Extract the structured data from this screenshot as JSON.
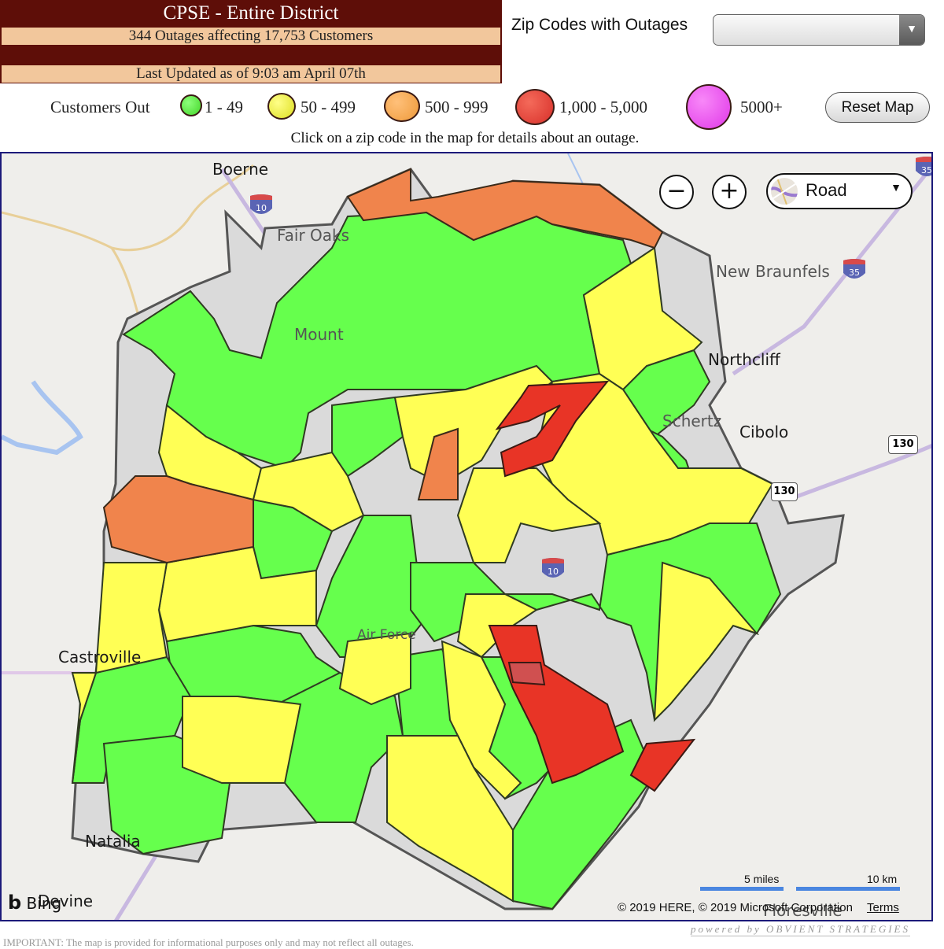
{
  "header": {
    "title": "CPSE - Entire District",
    "summary": "344 Outages affecting 17,753 Customers",
    "last_updated": "Last Updated as of 9:03 am April 07th"
  },
  "zip_filter": {
    "label": "Zip Codes with Outages",
    "selected": "",
    "arrow_icon": "▼"
  },
  "legend": {
    "title": "Customers Out",
    "items": [
      {
        "label": "1 - 49",
        "color": "#66ff4d"
      },
      {
        "label": "50 - 499",
        "color": "#ffff55"
      },
      {
        "label": "500 - 999",
        "color": "#f0844c"
      },
      {
        "label": "1,000 - 5,000",
        "color": "#e83426"
      },
      {
        "label": "5000+",
        "color": "#ee44ee"
      }
    ]
  },
  "reset_button": "Reset Map",
  "hint": "Click on a zip code in the map for details about an outage.",
  "map": {
    "zoom_out": "−",
    "zoom_in": "+",
    "map_style": "Road",
    "style_caret": "▼",
    "colors": {
      "green": "#66ff4d",
      "yellow": "#ffff55",
      "orange": "#f0844c",
      "red": "#e83426",
      "none": "#dcdcdc",
      "background": "#efeeeb",
      "border": "#1c1a7a"
    },
    "cities": [
      {
        "name": "Boerne"
      },
      {
        "name": "Fair Oaks"
      },
      {
        "name": "New Braunfels"
      },
      {
        "name": "Northcliff"
      },
      {
        "name": "Schertz"
      },
      {
        "name": "Cibolo"
      },
      {
        "name": "Castroville"
      },
      {
        "name": "Natalia"
      },
      {
        "name": "Devine"
      },
      {
        "name": "Floresville"
      },
      {
        "name": "Mount"
      },
      {
        "name": "Air Force"
      }
    ],
    "highways": [
      "10",
      "10",
      "35",
      "35",
      "130",
      "130"
    ],
    "scale": {
      "miles": "5 miles",
      "km": "10 km"
    },
    "copyright": "© 2019 HERE, © 2019 Microsoft Corporation",
    "terms": "Terms",
    "provider": "Bing"
  },
  "powered_by": "powered by OBVIENT STRATEGIES",
  "footnote": "IMPORTANT: The map is provided for informational purposes only and may not reflect all outages."
}
